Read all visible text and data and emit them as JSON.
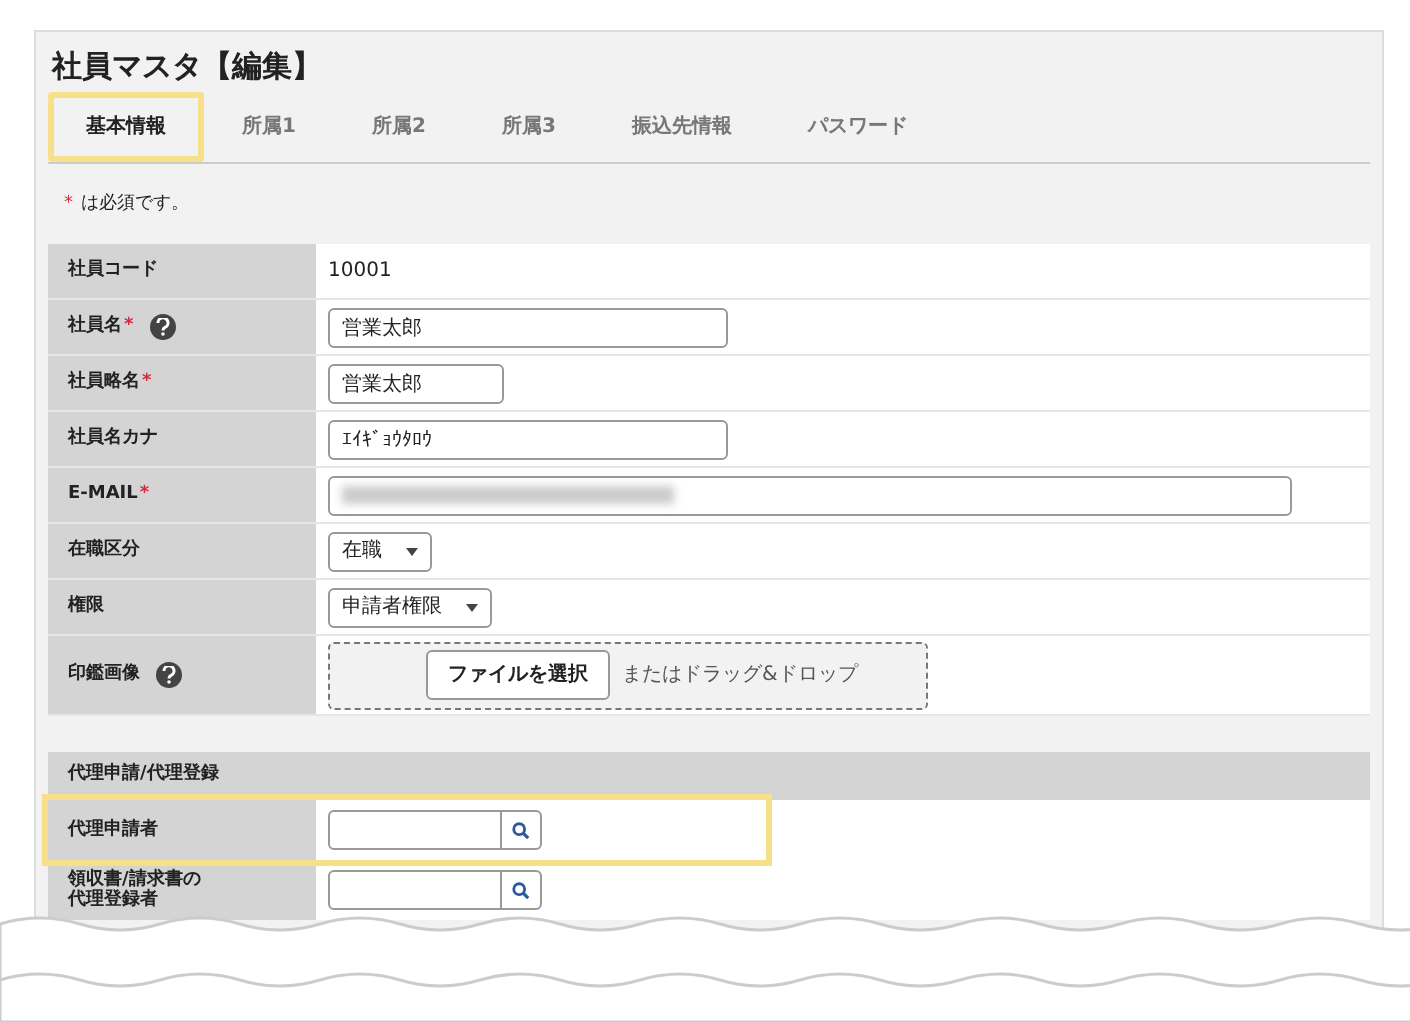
{
  "title": "社員マスタ【編集】",
  "tabs": [
    {
      "label": "基本情報",
      "selected": true,
      "highlighted": true
    },
    {
      "label": "所属1",
      "selected": false,
      "highlighted": false
    },
    {
      "label": "所属2",
      "selected": false,
      "highlighted": false
    },
    {
      "label": "所属3",
      "selected": false,
      "highlighted": false
    },
    {
      "label": "振込先情報",
      "selected": false,
      "highlighted": false
    },
    {
      "label": "パスワード",
      "selected": false,
      "highlighted": false
    }
  ],
  "required_note": {
    "mark": "*",
    "text": "は必須です。"
  },
  "rows": [
    {
      "label": "社員コード",
      "required": false,
      "help": false,
      "kind": "text",
      "value": "10001"
    },
    {
      "label": "社員名",
      "required": true,
      "help": true,
      "kind": "input",
      "value": "営業太郎",
      "wide": true
    },
    {
      "label": "社員略名",
      "required": true,
      "help": false,
      "kind": "input",
      "value": "営業太郎",
      "wide": false
    },
    {
      "label": "社員名カナ",
      "required": false,
      "help": false,
      "kind": "input",
      "value": "ｴｲｷﾞｮｳﾀﾛｳ",
      "wide": true
    },
    {
      "label": "E-MAIL",
      "required": true,
      "help": false,
      "kind": "blurred"
    },
    {
      "label": "在職区分",
      "required": false,
      "help": false,
      "kind": "select",
      "value": "在職"
    },
    {
      "label": "権限",
      "required": false,
      "help": false,
      "kind": "select",
      "value": "申請者権限"
    },
    {
      "label": "印鑑画像",
      "required": false,
      "help": true,
      "kind": "file",
      "button": "ファイルを選択",
      "hint": "またはドラッグ&ドロップ"
    }
  ],
  "section": {
    "title": "代理申請/代理登録",
    "rows": [
      {
        "label": "代理申請者",
        "highlighted": true
      },
      {
        "label": "領収書/請求書の代理登録者",
        "highlighted": false
      }
    ]
  }
}
